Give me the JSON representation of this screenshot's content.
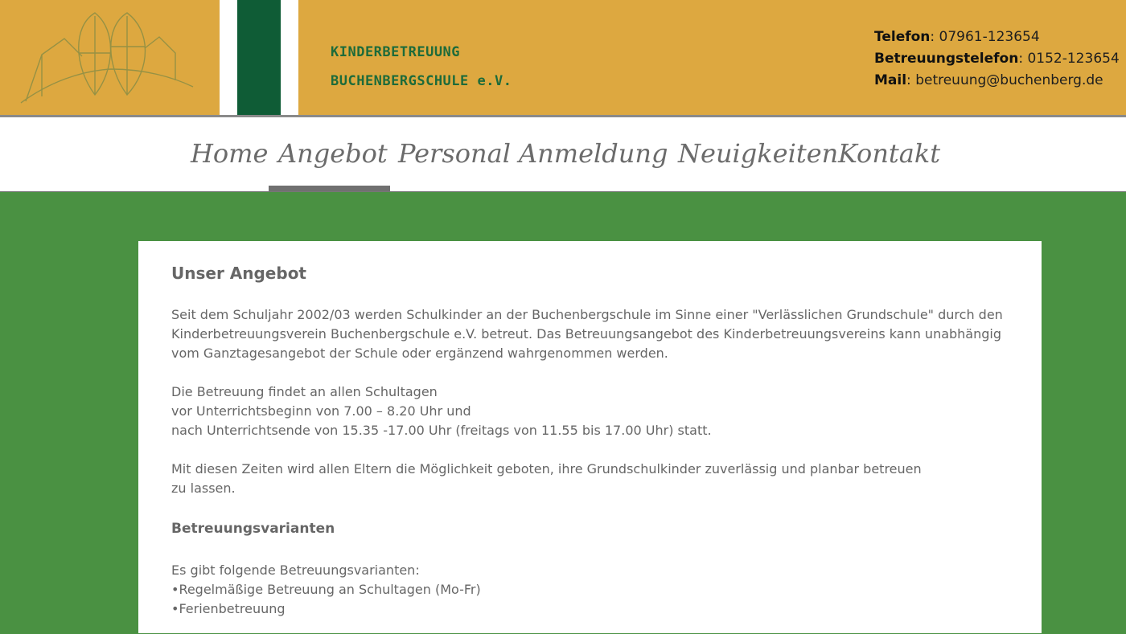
{
  "header": {
    "org_line1": "KINDERBETREUUNG",
    "org_line2": "BUCHENBERGSCHULE e.V.",
    "contact": [
      {
        "label": "Telefon",
        "value": "07961-123654"
      },
      {
        "label": "Betreuungstelefon",
        "value": "0152-123654"
      },
      {
        "label": "Mail",
        "value": "betreuung@buchenberg.de"
      }
    ],
    "colors": {
      "background": "#dda840",
      "stripe_green": "#0f5c36",
      "text_green": "#1d6b3a"
    }
  },
  "nav": {
    "items": [
      {
        "label": "Home"
      },
      {
        "label": "Angebot",
        "active": true
      },
      {
        "label": "Personal"
      },
      {
        "label": "Anmeldung"
      },
      {
        "label": "Neuigkeiten"
      },
      {
        "label": "Kontakt"
      }
    ]
  },
  "main": {
    "title": "Unser Angebot",
    "intro_lines": [
      "Seit dem Schuljahr 2002/03 werden Schulkinder an der Buchenbergschule im Sinne einer \"Verlässlichen Grundschule\" durch den",
      "Kinderbetreuungsverein Buchenbergschule e.V. betreut. Das Betreuungsangebot des Kinderbetreuungsvereins kann unabhängig",
      "vom Ganztagesangebot der Schule oder ergänzend wahrgenommen werden."
    ],
    "times_lines": [
      "Die Betreuung findet an allen Schultagen",
      "vor Unterrichtsbeginn von 7.00 – 8.20 Uhr und",
      "nach Unterrichtsende von 15.35 -17.00 Uhr (freitags von 11.55 bis 17.00 Uhr) statt."
    ],
    "parents_lines": [
      "Mit diesen Zeiten wird allen Eltern die Möglichkeit geboten, ihre Grundschulkinder zuverlässig und planbar betreuen",
      "zu lassen."
    ],
    "variants_title": "Betreuungsvarianten",
    "variants_intro": "Es gibt folgende Betreuungsvarianten:",
    "variants": [
      "•Regelmäßige Betreuung an Schultagen (Mo-Fr)",
      "•Ferienbetreuung"
    ],
    "colors": {
      "background": "#4a9142",
      "text": "#666666"
    }
  }
}
